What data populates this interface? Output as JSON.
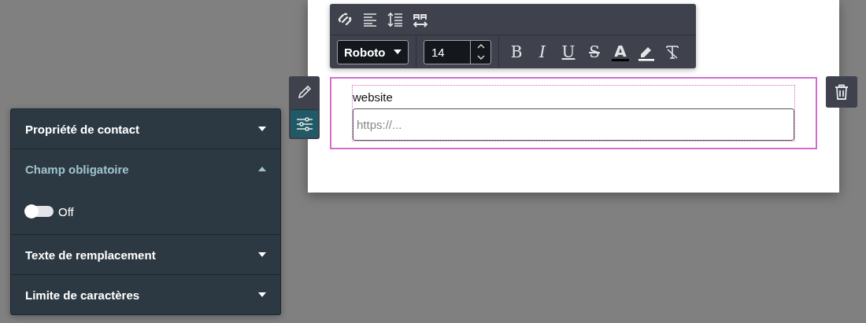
{
  "toolbar": {
    "tools": [
      {
        "kind": "unlink"
      },
      {
        "kind": "align"
      },
      {
        "kind": "line-height"
      },
      {
        "kind": "letter-spacing"
      }
    ],
    "font": "Roboto",
    "font_size": "14",
    "formats": [
      {
        "kind": "bold",
        "glyph": "B"
      },
      {
        "kind": "italic",
        "glyph": "I"
      },
      {
        "kind": "underline",
        "glyph": "U"
      },
      {
        "kind": "strike",
        "glyph": "S"
      },
      {
        "kind": "color",
        "glyph": "A",
        "color": "#000000"
      },
      {
        "kind": "highlight",
        "color": "#ffffff"
      },
      {
        "kind": "clear"
      }
    ]
  },
  "side_tools": [
    {
      "kind": "edit",
      "selected": false
    },
    {
      "kind": "settings",
      "selected": true
    }
  ],
  "field": {
    "label": "website",
    "placeholder": "https://..."
  },
  "panel": {
    "sections": [
      {
        "title": "Propriété de contact",
        "expanded": false
      },
      {
        "title": "Champ obligatoire",
        "expanded": true,
        "toggle": {
          "on": false,
          "label": "Off"
        }
      },
      {
        "title": "Texte de remplacement",
        "expanded": false
      },
      {
        "title": "Limite de caractères",
        "expanded": false
      }
    ]
  }
}
